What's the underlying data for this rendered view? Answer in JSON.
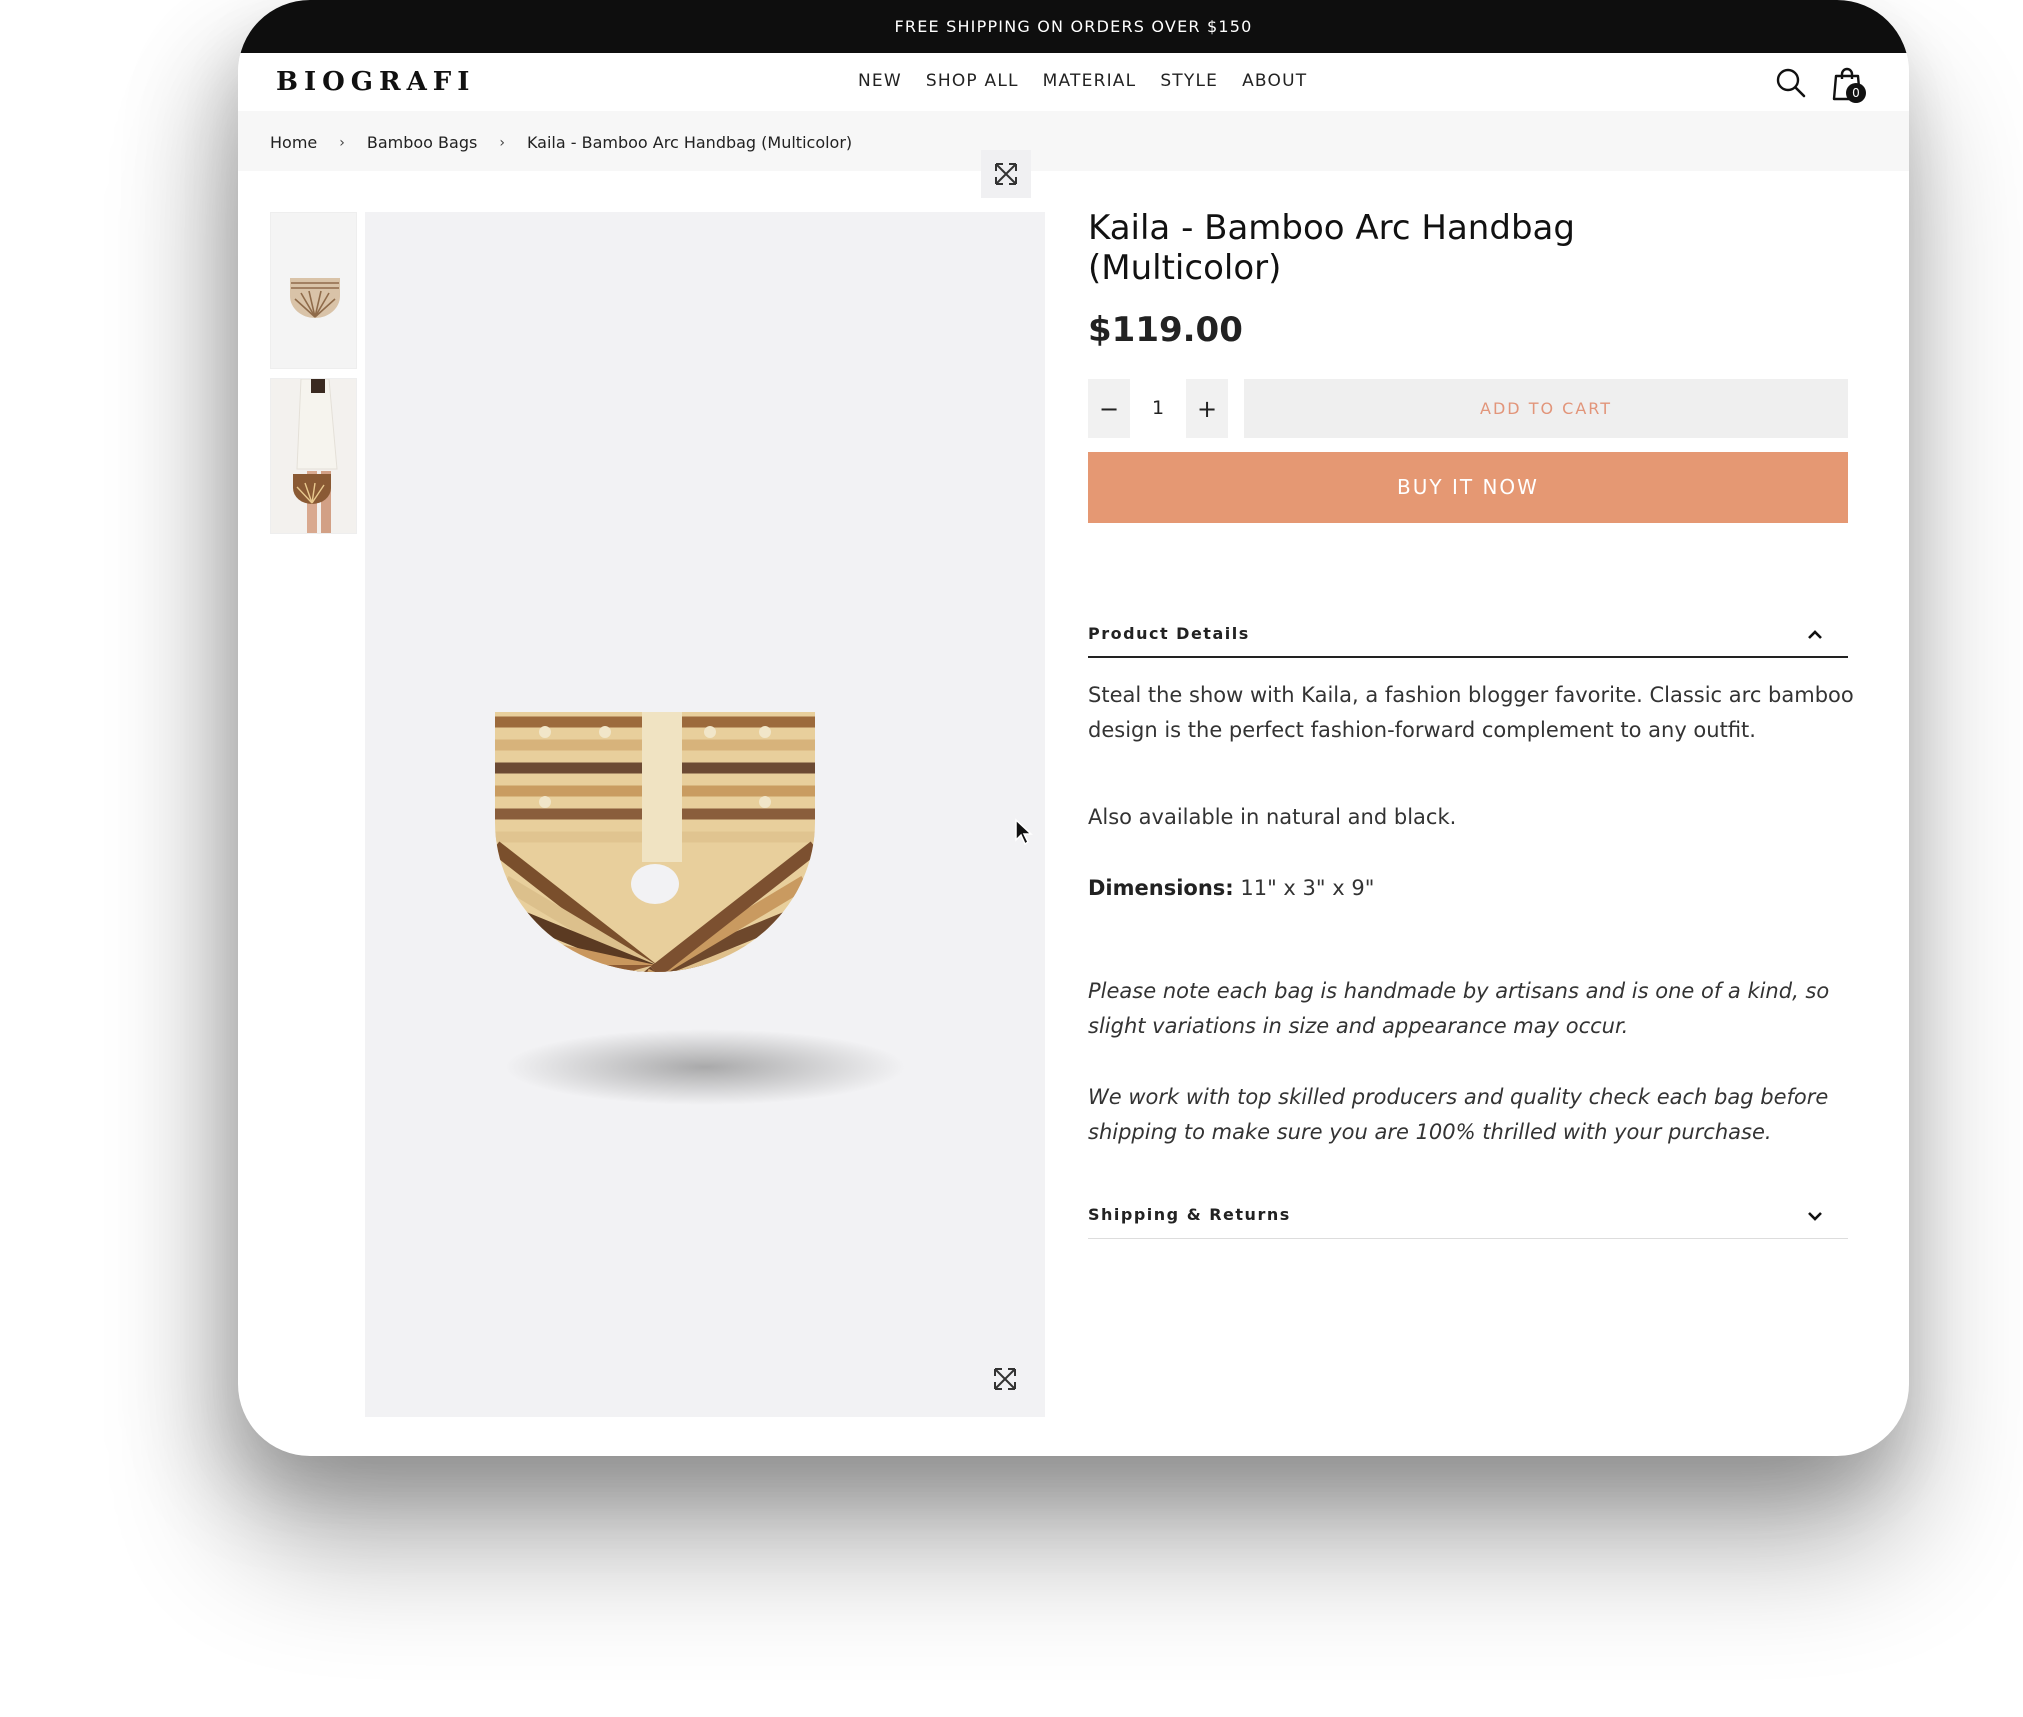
{
  "announcement": "FREE SHIPPING ON ORDERS OVER $150",
  "header": {
    "logo": "BIOGRAFI",
    "nav": [
      "NEW",
      "SHOP ALL",
      "MATERIAL",
      "STYLE",
      "ABOUT"
    ],
    "cart_count": "0",
    "icons": [
      "search-icon",
      "shopping-bag-icon"
    ]
  },
  "breadcrumb": {
    "items": [
      "Home",
      "Bamboo Bags",
      "Kaila - Bamboo Arc Handbag (Multicolor)"
    ],
    "separator": "›"
  },
  "product": {
    "title": "Kaila - Bamboo Arc Handbag (Multicolor)",
    "price": "$119.00",
    "quantity": "1",
    "qty_minus": "−",
    "qty_plus": "+",
    "add_to_cart": "ADD TO CART",
    "buy_now": "BUY IT NOW",
    "accent_color": "#e59873"
  },
  "details": {
    "heading": "Product Details",
    "p1": "Steal the show with Kaila, a fashion blogger favorite. Classic arc bamboo design is the perfect fashion-forward complement to any outfit.",
    "p2": "Also available in natural and black.",
    "dimensions_label": "Dimensions:",
    "dimensions_value": "11\" x 3\" x 9\"",
    "note1": "Please note each bag is handmade by artisans and is one of a kind, so slight variations in size and appearance may occur.",
    "note2": "We work with top skilled producers and quality check each bag before shipping to make sure you are 100% thrilled with your purchase."
  },
  "shipping": {
    "heading": "Shipping & Returns"
  }
}
